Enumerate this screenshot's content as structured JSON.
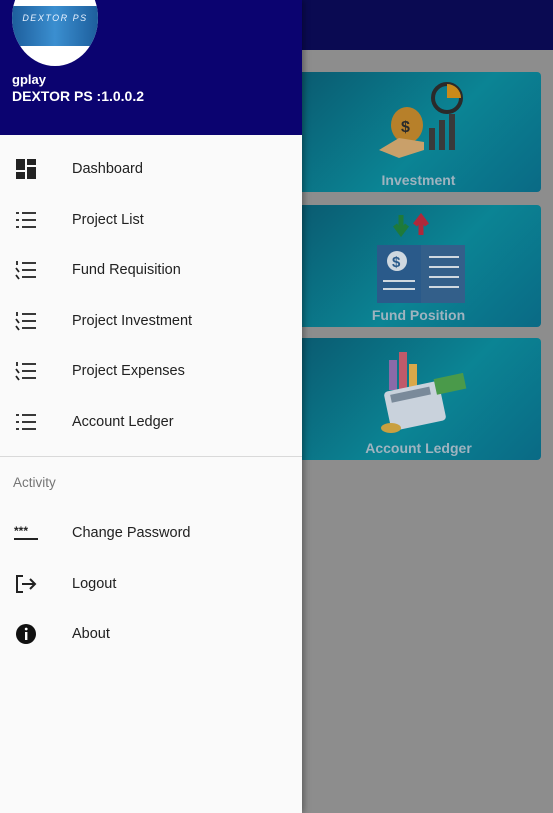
{
  "drawer": {
    "avatar_text": "DEXTOR PS",
    "user_name": "gplay",
    "app_version": "DEXTOR PS :1.0.0.2",
    "items": [
      {
        "label": "Dashboard",
        "icon": "dashboard-icon"
      },
      {
        "label": "Project List",
        "icon": "list-icon"
      },
      {
        "label": "Fund Requisition",
        "icon": "numbered-list-icon"
      },
      {
        "label": "Project Investment",
        "icon": "numbered-list-icon"
      },
      {
        "label": "Project Expenses",
        "icon": "numbered-list-icon"
      },
      {
        "label": "Account Ledger",
        "icon": "list-icon"
      }
    ],
    "activity_section": "Activity",
    "activity_items": [
      {
        "label": "Change Password",
        "icon": "password-icon"
      },
      {
        "label": "Logout",
        "icon": "logout-icon"
      },
      {
        "label": "About",
        "icon": "info-icon"
      }
    ]
  },
  "cards": [
    {
      "label": "Investment"
    },
    {
      "label": "Fund Position"
    },
    {
      "label": "Account Ledger"
    }
  ],
  "colors": {
    "header": "#0b0370",
    "app_bar": "#0a0a52",
    "card_accent": "#0b8494"
  }
}
